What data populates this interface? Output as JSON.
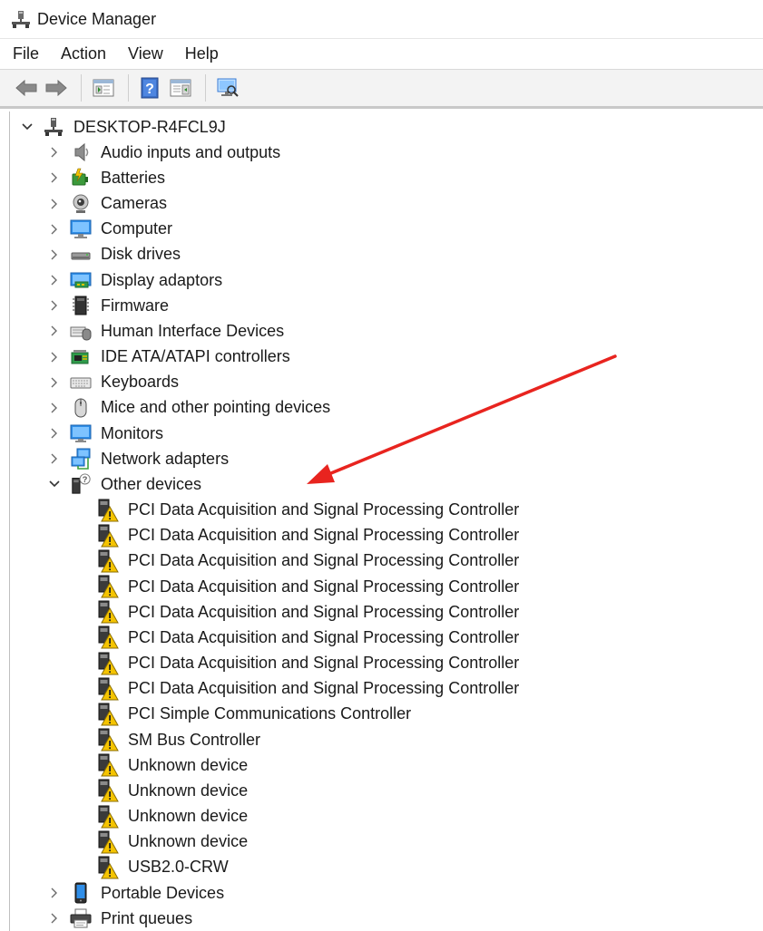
{
  "window": {
    "title": "Device Manager"
  },
  "menu": [
    {
      "name": "menu-file",
      "label": "File"
    },
    {
      "name": "menu-action",
      "label": "Action"
    },
    {
      "name": "menu-view",
      "label": "View"
    },
    {
      "name": "menu-help",
      "label": "Help"
    }
  ],
  "toolbar": [
    {
      "name": "back-button",
      "icon": "back-arrow-icon"
    },
    {
      "name": "forward-button",
      "icon": "forward-arrow-icon"
    },
    {
      "sep": true
    },
    {
      "name": "show-hide-console-tree-button",
      "icon": "console-tree-icon"
    },
    {
      "sep": true
    },
    {
      "name": "help-button",
      "icon": "help-icon"
    },
    {
      "name": "properties-pane-button",
      "icon": "pane-icon"
    },
    {
      "sep": true
    },
    {
      "name": "scan-hardware-button",
      "icon": "monitor-scan-icon"
    }
  ],
  "tree": {
    "root": {
      "label": "DESKTOP-R4FCL9J",
      "icon": "computer-tree-icon",
      "expanded": true
    },
    "categories": [
      {
        "label": "Audio inputs and outputs",
        "icon": "speaker-icon",
        "expanded": false
      },
      {
        "label": "Batteries",
        "icon": "battery-icon",
        "expanded": false
      },
      {
        "label": "Cameras",
        "icon": "camera-icon",
        "expanded": false
      },
      {
        "label": "Computer",
        "icon": "computer-icon",
        "expanded": false
      },
      {
        "label": "Disk drives",
        "icon": "disk-drive-icon",
        "expanded": false
      },
      {
        "label": "Display adaptors",
        "icon": "display-adapter-icon",
        "expanded": false
      },
      {
        "label": "Firmware",
        "icon": "firmware-icon",
        "expanded": false
      },
      {
        "label": "Human Interface Devices",
        "icon": "hid-icon",
        "expanded": false
      },
      {
        "label": "IDE ATA/ATAPI controllers",
        "icon": "ide-controller-icon",
        "expanded": false
      },
      {
        "label": "Keyboards",
        "icon": "keyboard-icon",
        "expanded": false
      },
      {
        "label": "Mice and other pointing devices",
        "icon": "mouse-icon",
        "expanded": false
      },
      {
        "label": "Monitors",
        "icon": "monitor-icon",
        "expanded": false
      },
      {
        "label": "Network adapters",
        "icon": "network-adapter-icon",
        "expanded": false
      },
      {
        "label": "Other devices",
        "icon": "unknown-device-icon",
        "expanded": true,
        "children": [
          {
            "label": "PCI Data Acquisition and Signal Processing Controller",
            "icon": "warning-device-icon"
          },
          {
            "label": "PCI Data Acquisition and Signal Processing Controller",
            "icon": "warning-device-icon"
          },
          {
            "label": "PCI Data Acquisition and Signal Processing Controller",
            "icon": "warning-device-icon"
          },
          {
            "label": "PCI Data Acquisition and Signal Processing Controller",
            "icon": "warning-device-icon"
          },
          {
            "label": "PCI Data Acquisition and Signal Processing Controller",
            "icon": "warning-device-icon"
          },
          {
            "label": "PCI Data Acquisition and Signal Processing Controller",
            "icon": "warning-device-icon"
          },
          {
            "label": "PCI Data Acquisition and Signal Processing Controller",
            "icon": "warning-device-icon"
          },
          {
            "label": "PCI Data Acquisition and Signal Processing Controller",
            "icon": "warning-device-icon"
          },
          {
            "label": "PCI Simple Communications Controller",
            "icon": "warning-device-icon"
          },
          {
            "label": "SM Bus Controller",
            "icon": "warning-device-icon"
          },
          {
            "label": "Unknown device",
            "icon": "warning-device-icon"
          },
          {
            "label": "Unknown device",
            "icon": "warning-device-icon"
          },
          {
            "label": "Unknown device",
            "icon": "warning-device-icon"
          },
          {
            "label": "Unknown device",
            "icon": "warning-device-icon"
          },
          {
            "label": "USB2.0-CRW",
            "icon": "warning-device-icon"
          }
        ]
      },
      {
        "label": "Portable Devices",
        "icon": "portable-device-icon",
        "expanded": false
      },
      {
        "label": "Print queues",
        "icon": "printer-icon",
        "expanded": false
      }
    ]
  },
  "colors": {
    "accent": "#1e88e5",
    "warning": "#f0b400",
    "annotation": "#e8241f"
  }
}
